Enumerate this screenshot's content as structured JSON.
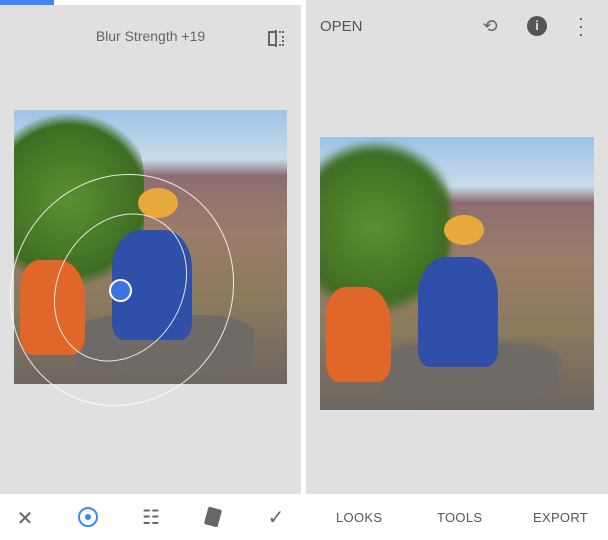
{
  "editor": {
    "title": "Blur Strength +19",
    "icons": [
      "compare-icon",
      "close-icon",
      "focus-point-icon",
      "adjust-sliders-icon",
      "style-cards-icon",
      "check-icon"
    ]
  },
  "main": {
    "open_label": "OPEN",
    "icons": [
      "undo-stack-icon",
      "info-icon",
      "more-vert-icon"
    ]
  },
  "tabs": [
    {
      "label": "LOOKS"
    },
    {
      "label": "TOOLS"
    },
    {
      "label": "EXPORT"
    }
  ],
  "colors": {
    "accent": "#4285f4",
    "panel": "#e0e0e0"
  }
}
